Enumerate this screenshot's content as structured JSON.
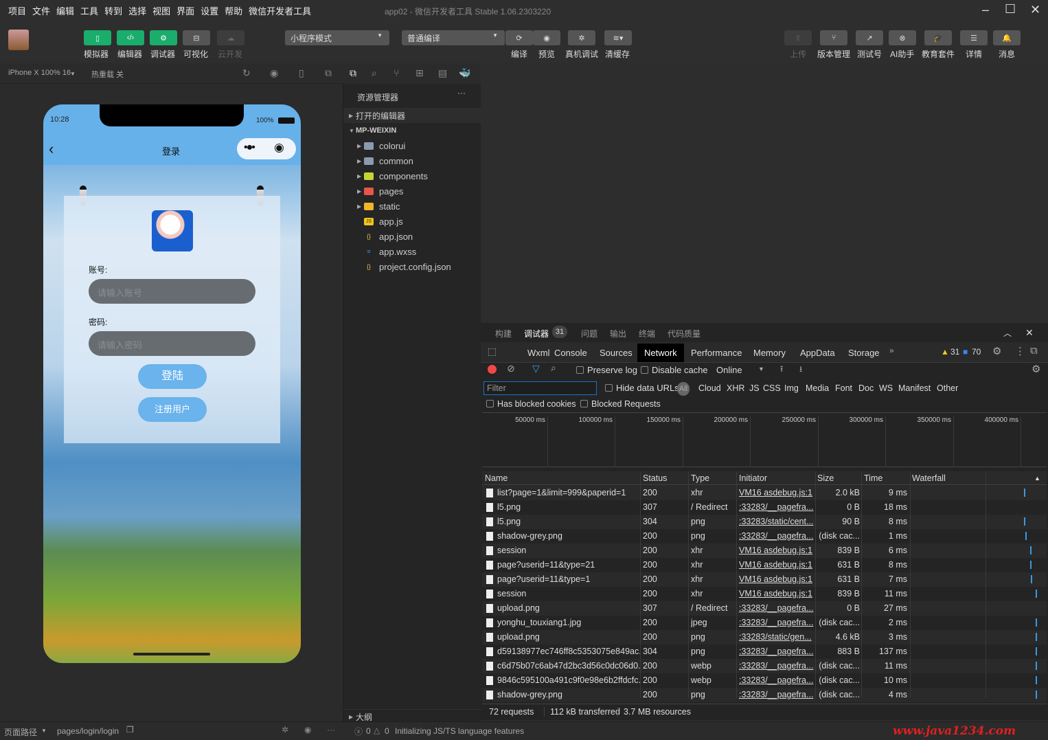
{
  "menu": [
    "项目",
    "文件",
    "编辑",
    "工具",
    "转到",
    "选择",
    "视图",
    "界面",
    "设置",
    "帮助",
    "微信开发者工具"
  ],
  "window_title": "app02 - 微信开发者工具 Stable 1.06.2303220",
  "toolbar": {
    "left": [
      {
        "label": "模拟器",
        "icon": "phone-icon"
      },
      {
        "label": "编辑器",
        "icon": "code-icon"
      },
      {
        "label": "调试器",
        "icon": "debug-icon"
      },
      {
        "label": "可视化",
        "icon": "layout-icon"
      },
      {
        "label": "云开发",
        "icon": "cloud-icon"
      }
    ],
    "mode_select": "小程序模式",
    "compile_select": "普通编译",
    "mid": [
      {
        "label": "编译",
        "icon": "refresh-icon"
      },
      {
        "label": "预览",
        "icon": "eye-icon"
      },
      {
        "label": "真机调试",
        "icon": "bug-icon"
      },
      {
        "label": "清缓存",
        "icon": "layers-icon"
      }
    ],
    "right": [
      {
        "label": "上传",
        "icon": "upload-icon"
      },
      {
        "label": "版本管理",
        "icon": "branch-icon"
      },
      {
        "label": "测试号",
        "icon": "external-link-icon"
      },
      {
        "label": "AI助手",
        "icon": "ai-icon"
      },
      {
        "label": "教育套件",
        "icon": "graduation-cap-icon"
      },
      {
        "label": "详情",
        "icon": "menu-icon"
      },
      {
        "label": "消息",
        "icon": "bell-icon"
      }
    ]
  },
  "simulator": {
    "device": "iPhone X 100% 16",
    "hot_reload": "热重载 关"
  },
  "phone": {
    "time": "10:28",
    "battery": "100%",
    "nav_title": "登录",
    "account_label": "账号:",
    "account_placeholder": "请输入账号",
    "password_label": "密码:",
    "password_placeholder": "请输入密码",
    "login_button": "登陆",
    "register_button": "注册用户"
  },
  "explorer": {
    "title": "资源管理器",
    "open_editors": "打开的编辑器",
    "project": "MP-WEIXIN",
    "items": [
      {
        "name": "colorui",
        "kind": "folder",
        "color": "#8a9bb0"
      },
      {
        "name": "common",
        "kind": "folder",
        "color": "#8a9bb0"
      },
      {
        "name": "components",
        "kind": "folder",
        "color": "#c5d534"
      },
      {
        "name": "pages",
        "kind": "folder",
        "color": "#e8564a"
      },
      {
        "name": "static",
        "kind": "folder",
        "color": "#f3b32a"
      },
      {
        "name": "app.js",
        "kind": "js",
        "color": "#f0c419"
      },
      {
        "name": "app.json",
        "kind": "json",
        "color": "#e8b84a"
      },
      {
        "name": "app.wxss",
        "kind": "css",
        "color": "#3d8fe0"
      },
      {
        "name": "project.config.json",
        "kind": "json",
        "color": "#e8b84a"
      }
    ],
    "outline": "大纲"
  },
  "devtools": {
    "top_tabs": [
      "构建",
      "调试器",
      "问题",
      "输出",
      "终端",
      "代码质量"
    ],
    "debugger_badge": "31",
    "tabs": [
      "Wxml",
      "Console",
      "Sources",
      "Network",
      "Performance",
      "Memory",
      "AppData",
      "Storage"
    ],
    "active_tab": "Network",
    "warnings": "31",
    "messages": "70",
    "preserve_log": "Preserve log",
    "disable_cache": "Disable cache",
    "throttle": "Online",
    "filter_placeholder": "Filter",
    "hide_data_urls": "Hide data URLs",
    "types": [
      "All",
      "Cloud",
      "XHR",
      "JS",
      "CSS",
      "Img",
      "Media",
      "Font",
      "Doc",
      "WS",
      "Manifest",
      "Other"
    ],
    "has_blocked_cookies": "Has blocked cookies",
    "blocked_requests": "Blocked Requests",
    "timeline_ticks": [
      "50000 ms",
      "100000 ms",
      "150000 ms",
      "200000 ms",
      "250000 ms",
      "300000 ms",
      "350000 ms",
      "400000 ms"
    ],
    "columns": [
      "Name",
      "Status",
      "Type",
      "Initiator",
      "Size",
      "Time",
      "Waterfall"
    ],
    "rows": [
      [
        "list?page=1&limit=999&paperid=1",
        "200",
        "xhr",
        "VM16 asdebug.js:1",
        "2.0 kB",
        "9 ms"
      ],
      [
        "l5.png",
        "307",
        "/ Redirect",
        ":33283/__pagefra...",
        "0 B",
        "18 ms"
      ],
      [
        "l5.png",
        "304",
        "png",
        ":33283/static/cent...",
        "90 B",
        "8 ms"
      ],
      [
        "shadow-grey.png",
        "200",
        "png",
        ":33283/__pagefra...",
        "(disk cac...",
        "1 ms"
      ],
      [
        "session",
        "200",
        "xhr",
        "VM16 asdebug.js:1",
        "839 B",
        "6 ms"
      ],
      [
        "page?userid=11&type=21",
        "200",
        "xhr",
        "VM16 asdebug.js:1",
        "631 B",
        "8 ms"
      ],
      [
        "page?userid=11&type=1",
        "200",
        "xhr",
        "VM16 asdebug.js:1",
        "631 B",
        "7 ms"
      ],
      [
        "session",
        "200",
        "xhr",
        "VM16 asdebug.js:1",
        "839 B",
        "11 ms"
      ],
      [
        "upload.png",
        "307",
        "/ Redirect",
        ":33283/__pagefra...",
        "0 B",
        "27 ms"
      ],
      [
        "yonghu_touxiang1.jpg",
        "200",
        "jpeg",
        ":33283/__pagefra...",
        "(disk cac...",
        "2 ms"
      ],
      [
        "upload.png",
        "200",
        "png",
        ":33283/static/gen...",
        "4.6 kB",
        "3 ms"
      ],
      [
        "d59138977ec746ff8c5353075e849ac...",
        "304",
        "png",
        ":33283/__pagefra...",
        "883 B",
        "137 ms"
      ],
      [
        "c6d75b07c6ab47d2bc3d56c0dc06d0...",
        "200",
        "webp",
        ":33283/__pagefra...",
        "(disk cac...",
        "11 ms"
      ],
      [
        "9846c595100a491c9f0e98e6b2ffdcfc...",
        "200",
        "webp",
        ":33283/__pagefra...",
        "(disk cac...",
        "10 ms"
      ],
      [
        "shadow-grey.png",
        "200",
        "png",
        ":33283/__pagefra...",
        "(disk cac...",
        "4 ms"
      ]
    ],
    "footer": {
      "requests": "72 requests",
      "transferred": "112 kB transferred",
      "resources": "3.7 MB resources"
    }
  },
  "statusbar": {
    "page_path_label": "页面路径",
    "page_path": "pages/login/login",
    "errors": "0",
    "warnings": "0",
    "message": "Initializing JS/TS language features"
  },
  "watermark": "www.java1234.com"
}
